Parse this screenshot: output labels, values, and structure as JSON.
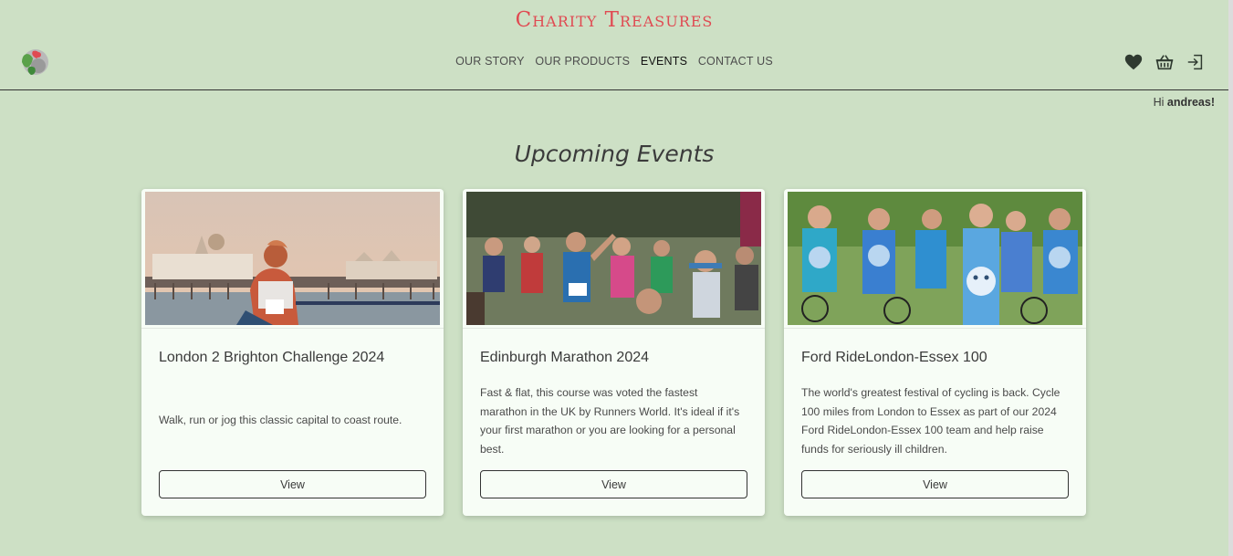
{
  "brand": {
    "title": "Charity Treasures"
  },
  "nav": {
    "items": [
      {
        "label": "OUR STORY"
      },
      {
        "label": "OUR PRODUCTS"
      },
      {
        "label": "EVENTS"
      },
      {
        "label": "CONTACT US"
      }
    ],
    "active": "EVENTS"
  },
  "header_icons": [
    "heart-icon",
    "basket-icon",
    "login-icon"
  ],
  "greeting": {
    "prefix": "Hi ",
    "user": "andreas!"
  },
  "section": {
    "title": "Upcoming Events"
  },
  "events": [
    {
      "title": "London 2 Brighton Challenge 2024",
      "description": "Walk, run or jog this classic capital to coast route.",
      "button": "View"
    },
    {
      "title": "Edinburgh Marathon 2024",
      "description": "Fast & flat, this course was voted the fastest marathon in the UK by Runners World. It's ideal if it's your first marathon or you are looking for a personal best.",
      "button": "View"
    },
    {
      "title": "Ford RideLondon-Essex 100",
      "description": "The world's greatest festival of cycling is back. Cycle 100 miles from London to Essex as part of our 2024 Ford RideLondon-Essex 100 team and help raise funds for seriously ill children.",
      "button": "View"
    }
  ],
  "colors": {
    "background": "#cde0c5",
    "brand": "#e04a52",
    "card": "#f7fdf6"
  }
}
